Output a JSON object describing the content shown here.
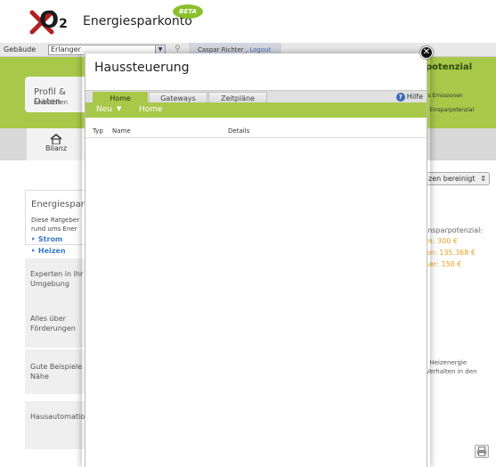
{
  "header": {
    "app_title": "Energiesparkonto",
    "beta_badge": "BETA",
    "logo_text": "O",
    "logo_sub": "2"
  },
  "topbar": {
    "building_label": "Gebäude",
    "building_value": "Erlanger",
    "user_name": "Caspar Richter ,",
    "logout": "Logout"
  },
  "profile_card": {
    "title": "Profil & Daten",
    "subtitle": "bearbeiten"
  },
  "right_card": {
    "title": "potenzial",
    "line1": "rs Emissionen",
    "line2": "r Einsparpotenzial"
  },
  "nav": {
    "bilanz": "Bilanz"
  },
  "sidebar": {
    "energie": {
      "title": "Energiespar-",
      "desc_1": "Diese Ratgeber",
      "desc_2": "rund ums Ener",
      "link_strom": "Strom",
      "link_heizen": "Heizen"
    },
    "cards": [
      {
        "line1": "Experten in Ihr",
        "line2": "Umgebung"
      },
      {
        "line1": "Alles über",
        "line2": "Förderungen"
      },
      {
        "line1": "Gute Beispiele",
        "line2": "Nähe"
      },
      {
        "line1": "Hausautomatio",
        "line2": ""
      }
    ]
  },
  "right_panel": {
    "dropdown": "zen bereinigt",
    "lines": [
      {
        "text": "insparpotenzial:",
        "color": "#666666"
      },
      {
        "text": "m: 300 €",
        "color": "#e8a020"
      },
      {
        "text": "en: 135.368 €",
        "color": "#e8a020"
      },
      {
        "text": "ser: 150 €",
        "color": "#e8a020"
      }
    ],
    "note_1": ", Heizenergie",
    "note_2": "Verhalten in den"
  },
  "modal": {
    "title": "Haussteuerung",
    "tabs": [
      {
        "label": "Home",
        "active": true
      },
      {
        "label": "Gateways",
        "active": false
      },
      {
        "label": "Zeitpläne",
        "active": false
      }
    ],
    "help": "Hilfe",
    "new_menu": "Neu",
    "breadcrumb": "Home",
    "columns": [
      "Typ",
      "Name",
      "Details"
    ]
  },
  "colors": {
    "brand_green": "#a8c84a",
    "link_blue": "#3a7abf",
    "accent_orange": "#e8a020"
  },
  "icons": [
    "logo-cross-icon",
    "search-icon",
    "home-icon",
    "close-icon",
    "help-icon",
    "print-icon",
    "chevron-down-icon"
  ]
}
